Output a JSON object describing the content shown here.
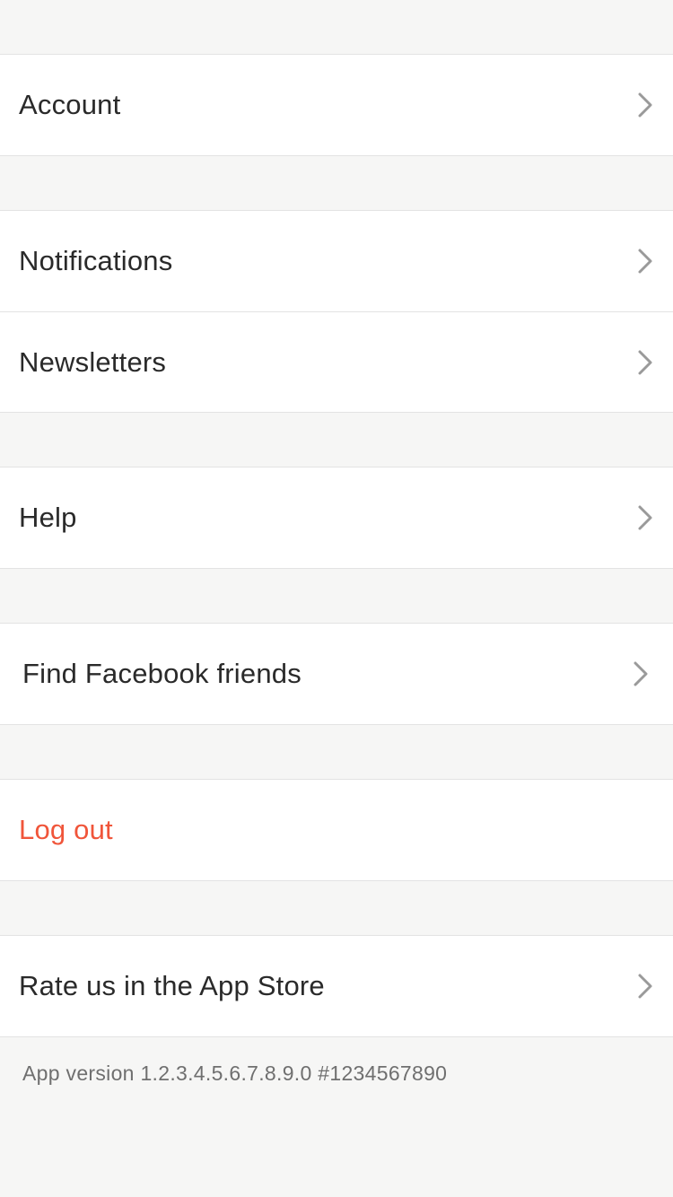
{
  "settings": {
    "account": {
      "label": "Account",
      "icon": "chevron-right-icon"
    },
    "notifications": {
      "label": "Notifications",
      "icon": "chevron-right-icon"
    },
    "newsletters": {
      "label": "Newsletters",
      "icon": "chevron-right-icon"
    },
    "help": {
      "label": "Help",
      "icon": "chevron-right-icon"
    },
    "find_facebook_friends": {
      "label": "Find Facebook friends",
      "icon": "chevron-right-icon"
    },
    "log_out": {
      "label": "Log out",
      "color": "#f0553a"
    },
    "rate_app": {
      "label": "Rate us in the App Store",
      "icon": "chevron-right-icon"
    }
  },
  "footer": {
    "app_version": "App version 1.2.3.4.5.6.7.8.9.0 #1234567890"
  },
  "colors": {
    "background": "#f6f6f5",
    "row_background": "#ffffff",
    "text": "#2a2a2a",
    "danger": "#f0553a",
    "chevron": "#9a9a9a"
  }
}
